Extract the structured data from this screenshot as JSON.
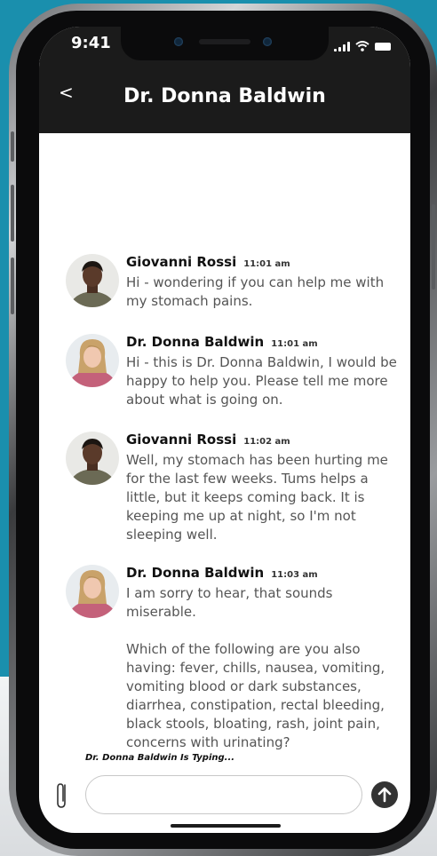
{
  "status_bar": {
    "time": "9:41"
  },
  "header": {
    "back_label": "<",
    "title": "Dr. Donna Baldwin"
  },
  "messages": [
    {
      "sender": "Giovanni Rossi",
      "time": "11:01 am",
      "avatar": "avatar-giovanni",
      "text": "Hi - wondering if you can help me with my stomach pains."
    },
    {
      "sender": "Dr. Donna Baldwin",
      "time": "11:01 am",
      "avatar": "avatar-donna",
      "text": "Hi - this is Dr. Donna Baldwin, I would be happy to help you. Please tell me more about what is going on."
    },
    {
      "sender": "Giovanni Rossi",
      "time": "11:02 am",
      "avatar": "avatar-giovanni",
      "text": "Well, my stomach has been hurting me for the last few weeks. Tums helps a little, but it keeps coming back. It is keeping me up at night, so I'm not sleeping well."
    },
    {
      "sender": "Dr. Donna Baldwin",
      "time": "11:03 am",
      "avatar": "avatar-donna",
      "text": "I am sorry to hear, that sounds miserable.\n\nWhich of the following are you also having: fever, chills, nausea, vomiting, vomiting blood or dark substances, diarrhea, constipation, rectal bleeding, black stools, bloating, rash, joint pain, concerns with urinating?"
    }
  ],
  "typing_indicator": "Dr. Donna Baldwin Is Typing...",
  "composer": {
    "value": "",
    "placeholder": ""
  },
  "colors": {
    "background": "#1a8fad",
    "header": "#1b1b1b",
    "text_secondary": "#555555"
  }
}
